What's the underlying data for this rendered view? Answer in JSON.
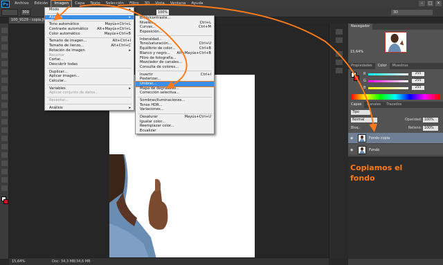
{
  "menubar": {
    "logo": "Ps",
    "items": [
      "Archivo",
      "Edición",
      "Imagen",
      "Capa",
      "Texto",
      "Selección",
      "Filtro",
      "3D",
      "Vista",
      "Ventana",
      "Ayuda"
    ]
  },
  "options": {
    "opacity": "100%",
    "brush_size": "300",
    "workspace": "3D"
  },
  "document": {
    "tab_title": "100_9129 - copia.JPG",
    "zoom": "15,64%",
    "doc_info": "Doc: 34,3 MB/34,6 MB"
  },
  "imagen_menu": [
    {
      "label": "Modo",
      "sc": "▸"
    },
    {
      "sep": true
    },
    {
      "label": "Ajustes",
      "sc": "▸",
      "hl": true
    },
    {
      "sep": true
    },
    {
      "label": "Tono automático",
      "sc": "Mayús+Ctrl+L"
    },
    {
      "label": "Contraste automático",
      "sc": "Alt+Mayús+Ctrl+L"
    },
    {
      "label": "Color automático",
      "sc": "Mayús+Ctrl+B"
    },
    {
      "sep": true
    },
    {
      "label": "Tamaño de imagen...",
      "sc": "Alt+Ctrl+I"
    },
    {
      "label": "Tamaño de lienzo...",
      "sc": "Alt+Ctrl+C"
    },
    {
      "label": "Rotación de imagen",
      "sc": "▸"
    },
    {
      "label": "Recortar",
      "disabled": true
    },
    {
      "label": "Cortar..."
    },
    {
      "label": "Descubrir todas"
    },
    {
      "sep": true
    },
    {
      "label": "Duplicar..."
    },
    {
      "label": "Aplicar imagen..."
    },
    {
      "label": "Calcular..."
    },
    {
      "sep": true
    },
    {
      "label": "Variables",
      "sc": "▸"
    },
    {
      "label": "Aplicar conjunto de datos...",
      "disabled": true
    },
    {
      "sep": true
    },
    {
      "label": "Reventar...",
      "disabled": true
    },
    {
      "sep": true
    },
    {
      "label": "Análisis",
      "sc": "▸"
    }
  ],
  "ajustes_menu": [
    {
      "label": "Brillo/contraste..."
    },
    {
      "label": "Niveles...",
      "sc": "Ctrl+L"
    },
    {
      "label": "Curvas...",
      "sc": "Ctrl+M"
    },
    {
      "label": "Exposición..."
    },
    {
      "sep": true
    },
    {
      "label": "Intensidad..."
    },
    {
      "label": "Tono/saturación...",
      "sc": "Ctrl+U"
    },
    {
      "label": "Equilibrio de color...",
      "sc": "Ctrl+B"
    },
    {
      "label": "Blanco y negro...",
      "sc": "Alt+Mayús+Ctrl+B"
    },
    {
      "label": "Filtro de fotografía..."
    },
    {
      "label": "Mezclador de canales..."
    },
    {
      "label": "Consulta de colores..."
    },
    {
      "sep": true
    },
    {
      "label": "Invertir",
      "sc": "Ctrl+I"
    },
    {
      "label": "Posterizar..."
    },
    {
      "label": "Umbral...",
      "hl": true,
      "boxed": true
    },
    {
      "label": "Mapa de degradado..."
    },
    {
      "label": "Corrección selectiva..."
    },
    {
      "sep": true
    },
    {
      "label": "Sombras/iluminaciones..."
    },
    {
      "label": "Tonos HDR..."
    },
    {
      "label": "Variaciones..."
    },
    {
      "sep": true
    },
    {
      "label": "Desaturar",
      "sc": "Mayús+Ctrl+U"
    },
    {
      "label": "Igualar color..."
    },
    {
      "label": "Reemplazar color..."
    },
    {
      "label": "Ecualizar"
    }
  ],
  "navigator": {
    "tab": "Navegador",
    "zoom": "15,64%"
  },
  "color_panel": {
    "tabs": [
      "Propiedades",
      "Color",
      "Muestras"
    ],
    "channels": [
      {
        "label": "R",
        "value": "255"
      },
      {
        "label": "G",
        "value": "255"
      },
      {
        "label": "B",
        "value": "255"
      }
    ]
  },
  "layers_panel": {
    "tabs": [
      "Capas",
      "Canales",
      "Trazados"
    ],
    "filter": "Tipo",
    "blend_mode": "Normal",
    "opacity_label": "Opacidad:",
    "opacity_value": "100%",
    "lock_label": "Bloq.:",
    "fill_label": "Relleno:",
    "fill_value": "100%",
    "layers": [
      {
        "name": "Fondo copia",
        "selected": true
      },
      {
        "name": "Fondo",
        "selected": false
      }
    ]
  },
  "annotation": {
    "line1": "Copiamos el",
    "line2": "fondo",
    "color": "#ff7a1a"
  }
}
